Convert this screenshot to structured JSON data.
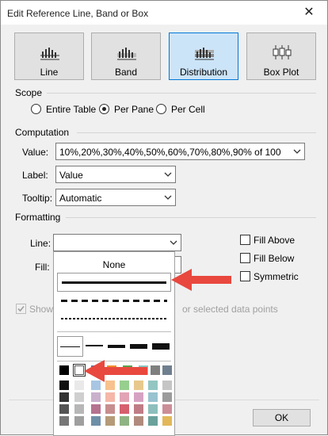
{
  "window": {
    "title": "Edit Reference Line, Band or Box",
    "close": "✕"
  },
  "types": [
    {
      "label": "Line",
      "icon": "line-chart-icon"
    },
    {
      "label": "Band",
      "icon": "band-chart-icon"
    },
    {
      "label": "Distribution",
      "icon": "distribution-chart-icon",
      "selected": true
    },
    {
      "label": "Box Plot",
      "icon": "box-plot-icon"
    }
  ],
  "scope": {
    "title": "Scope",
    "options": [
      "Entire Table",
      "Per Pane",
      "Per Cell"
    ],
    "selected": "Per Pane"
  },
  "computation": {
    "title": "Computation",
    "value_label": "Value:",
    "value": "10%,20%,30%,40%,50%,60%,70%,80%,90% of 100",
    "label_label": "Label:",
    "label_value": "Value",
    "tooltip_label": "Tooltip:",
    "tooltip_value": "Automatic"
  },
  "formatting": {
    "title": "Formatting",
    "line_label": "Line:",
    "fill_label": "Fill:",
    "line_value": "",
    "fill_above": "Fill Above",
    "fill_below": "Fill Below",
    "symmetric": "Symmetric"
  },
  "show": {
    "label_start": "Show",
    "label_end": "or selected data points",
    "checked": true
  },
  "dropdown": {
    "none_label": "None",
    "line_styles": [
      "solid",
      "dashed",
      "dotted"
    ],
    "selected_style": "solid",
    "widths": [
      "1",
      "2",
      "3",
      "4",
      "5"
    ],
    "selected_width": "1",
    "colors_row1": [
      "#000000",
      "#ffffff",
      "#4e79a7",
      "#f28e2b",
      "#59a14f",
      "#8cc6c2",
      "#7f7f7f",
      "#6f7f8f"
    ],
    "selected_color": "#ffffff",
    "gray_columns": [
      [
        "#111111",
        "#333333",
        "#555555",
        "#777777"
      ],
      [
        "#e9e9e9",
        "#cfcfcf",
        "#b7b7b7",
        "#9f9f9f"
      ]
    ],
    "color_columns": [
      [
        "#a8c6e3",
        "#c9b1cc",
        "#b5738f",
        "#6e8fa8"
      ],
      [
        "#f7c28d",
        "#f5b7a7",
        "#c78e8e",
        "#b59b77"
      ],
      [
        "#97cf8f",
        "#e2a4b5",
        "#d6606d",
        "#8fb383"
      ],
      [
        "#e7c98d",
        "#d6a2c3",
        "#bf7c86",
        "#b08b7d"
      ],
      [
        "#93c6c2",
        "#99c3d0",
        "#8dbfbc",
        "#6aa19b"
      ],
      [
        "#c5c5c5",
        "#9c9c9c",
        "#cc8e97",
        "#e3b85a"
      ]
    ]
  },
  "annotation": {
    "arrow_color": "#e8483e"
  },
  "buttons": {
    "ok": "OK"
  }
}
